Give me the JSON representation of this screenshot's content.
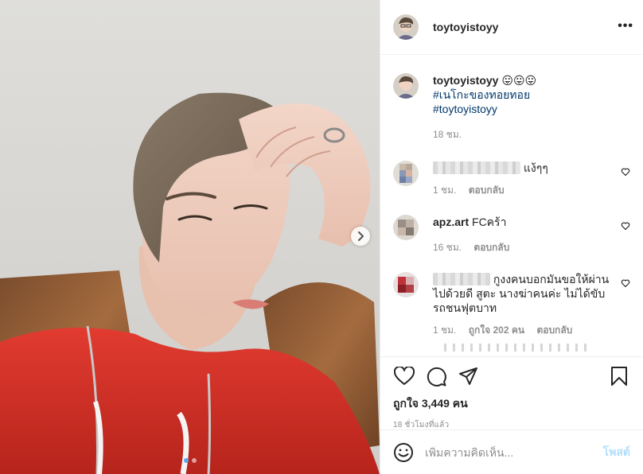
{
  "post": {
    "author": "toytoyistoyy",
    "more_label": "•••",
    "caption": {
      "username": "toytoyistoyy",
      "emojis": "😛😛😛",
      "tag1": "#เนโกะของทอยทอย",
      "tag2": "#toytoyistoyy",
      "time": "18 ชม."
    },
    "comments": [
      {
        "username_hidden": true,
        "text": "แง้ๆๆ",
        "time": "1 ชม.",
        "reply": "ตอบกลับ"
      },
      {
        "username": "apz.art",
        "text": "FCคร้า",
        "time": "16 ชม.",
        "reply": "ตอบกลับ"
      },
      {
        "username_hidden": true,
        "text": "กูงงคนบอกมันขอให้ผ่านไปด้วยดี สูตะ นางฆ่าคนค่ะ ไม่ได้ขับรถชนฟุตบาท",
        "time": "1 ชม.",
        "likes": "ถูกใจ 202 คน",
        "reply": "ตอบกลับ"
      }
    ],
    "likes": "ถูกใจ 3,449 คน",
    "timestamp": "18 ชั่วโมงที่แล้ว",
    "add_comment_placeholder": "เพิ่มความคิดเห็น...",
    "post_button": "โพสต์"
  },
  "carousel": {
    "count": 2,
    "active_index": 0
  },
  "icons": {
    "more": "more-horizontal-icon",
    "next": "chevron-right-icon",
    "like": "heart-icon",
    "comment": "speech-bubble-icon",
    "share": "paper-plane-icon",
    "save": "bookmark-icon",
    "emoji": "smiley-icon"
  },
  "colors": {
    "link": "#00376b",
    "muted": "#8e8e8e",
    "post_button": "#b2dffc",
    "hoodie": "#d6322a",
    "active_dot": "#5aa7f0"
  }
}
